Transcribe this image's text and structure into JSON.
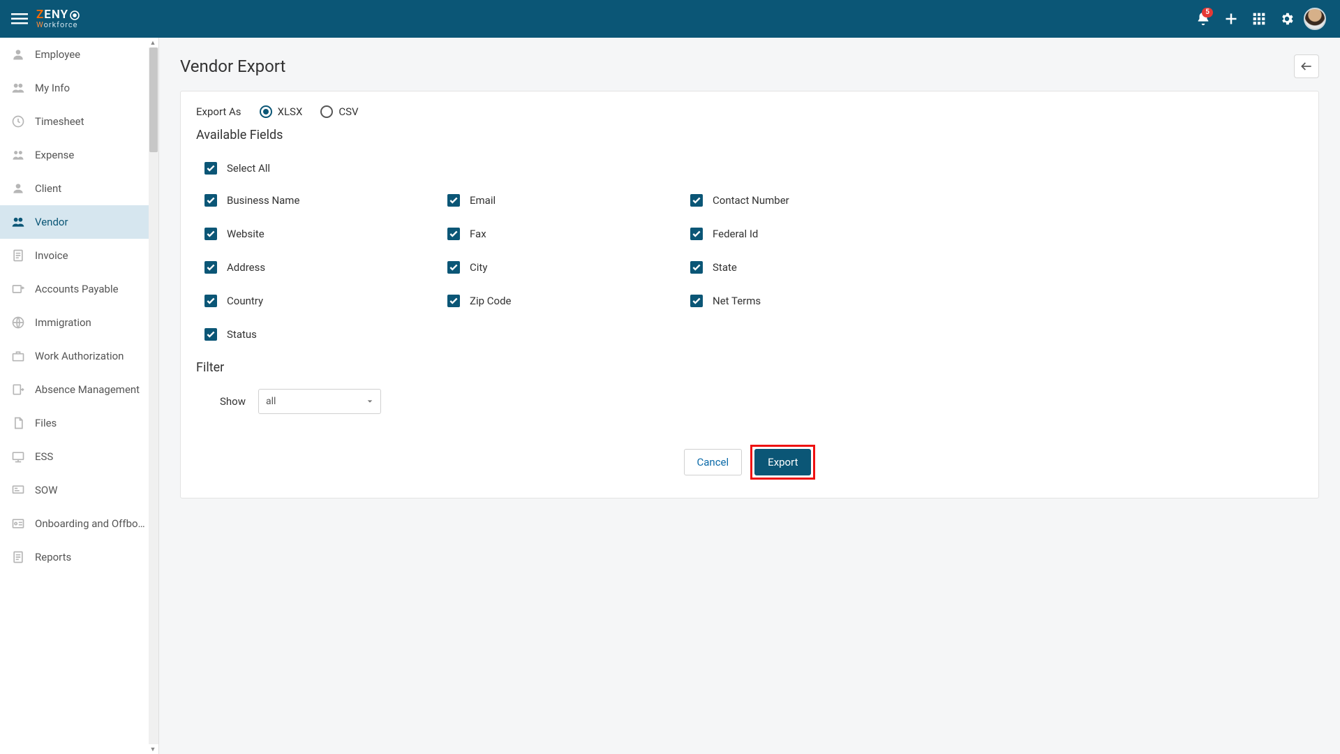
{
  "header": {
    "brand_top_pre": "Z",
    "brand_top_rest": "ENY",
    "brand_top_o": "O",
    "brand_bottom_pre": "W",
    "brand_bottom_rest": "orkforce",
    "notification_count": "5"
  },
  "sidebar": {
    "items": [
      {
        "label": "Employee",
        "icon": "person"
      },
      {
        "label": "My Info",
        "icon": "my-info"
      },
      {
        "label": "Timesheet",
        "icon": "clock"
      },
      {
        "label": "Expense",
        "icon": "expense"
      },
      {
        "label": "Client",
        "icon": "client"
      },
      {
        "label": "Vendor",
        "icon": "vendor",
        "active": true
      },
      {
        "label": "Invoice",
        "icon": "invoice"
      },
      {
        "label": "Accounts Payable",
        "icon": "accounts-payable"
      },
      {
        "label": "Immigration",
        "icon": "globe"
      },
      {
        "label": "Work Authorization",
        "icon": "briefcase"
      },
      {
        "label": "Absence Management",
        "icon": "absence"
      },
      {
        "label": "Files",
        "icon": "files"
      },
      {
        "label": "ESS",
        "icon": "ess"
      },
      {
        "label": "SOW",
        "icon": "sow"
      },
      {
        "label": "Onboarding and Offboa...",
        "icon": "onboarding"
      },
      {
        "label": "Reports",
        "icon": "reports"
      }
    ]
  },
  "page": {
    "title": "Vendor Export",
    "export_as_label": "Export As",
    "radio_options": [
      {
        "label": "XLSX",
        "checked": true
      },
      {
        "label": "CSV",
        "checked": false
      }
    ],
    "available_fields_title": "Available Fields",
    "select_all_label": "Select All",
    "fields": [
      "Business Name",
      "Email",
      "Contact Number",
      "Website",
      "Fax",
      "Federal Id",
      "Address",
      "City",
      "State",
      "Country",
      "Zip Code",
      "Net Terms",
      "Status"
    ],
    "filter_title": "Filter",
    "show_label": "Show",
    "show_value": "all",
    "cancel_label": "Cancel",
    "export_label": "Export"
  }
}
